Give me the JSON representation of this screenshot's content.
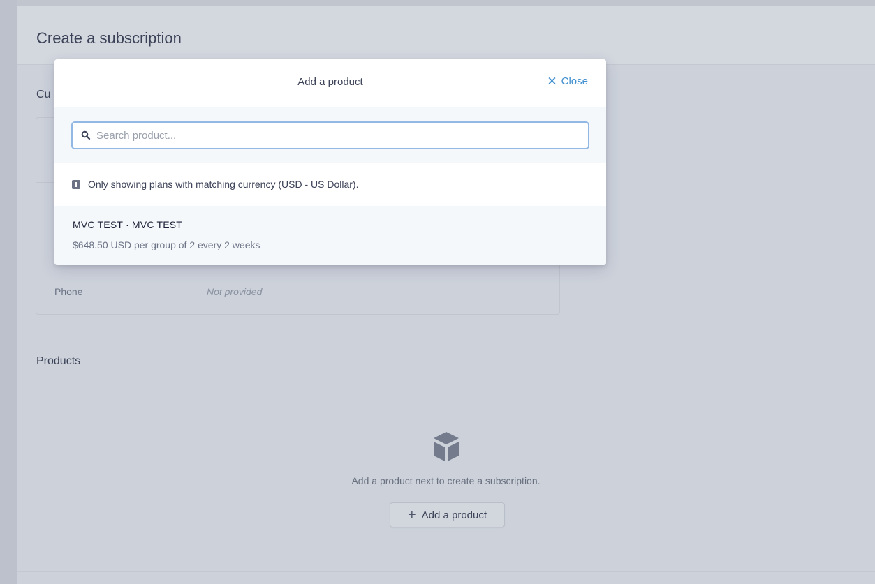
{
  "page": {
    "title": "Create a subscription"
  },
  "customer": {
    "section_label": "Cu",
    "phone_label": "Phone",
    "phone_value": "Not provided"
  },
  "products": {
    "section_label": "Products",
    "empty_text": "Add a product next to create a subscription.",
    "add_button_label": "Add a product",
    "icon": "box-icon"
  },
  "modal": {
    "title": "Add a product",
    "close_label": "Close",
    "search": {
      "placeholder": "Search product...",
      "value": ""
    },
    "notice": "Only showing plans with matching currency (USD - US Dollar).",
    "results": [
      {
        "name": "MVC TEST · MVC TEST",
        "detail": "$648.50 USD per group of 2 every 2 weeks"
      }
    ]
  },
  "colors": {
    "accent": "#3f8fcf",
    "search_border": "#92b8e3",
    "overlay": "#ccd1da"
  }
}
